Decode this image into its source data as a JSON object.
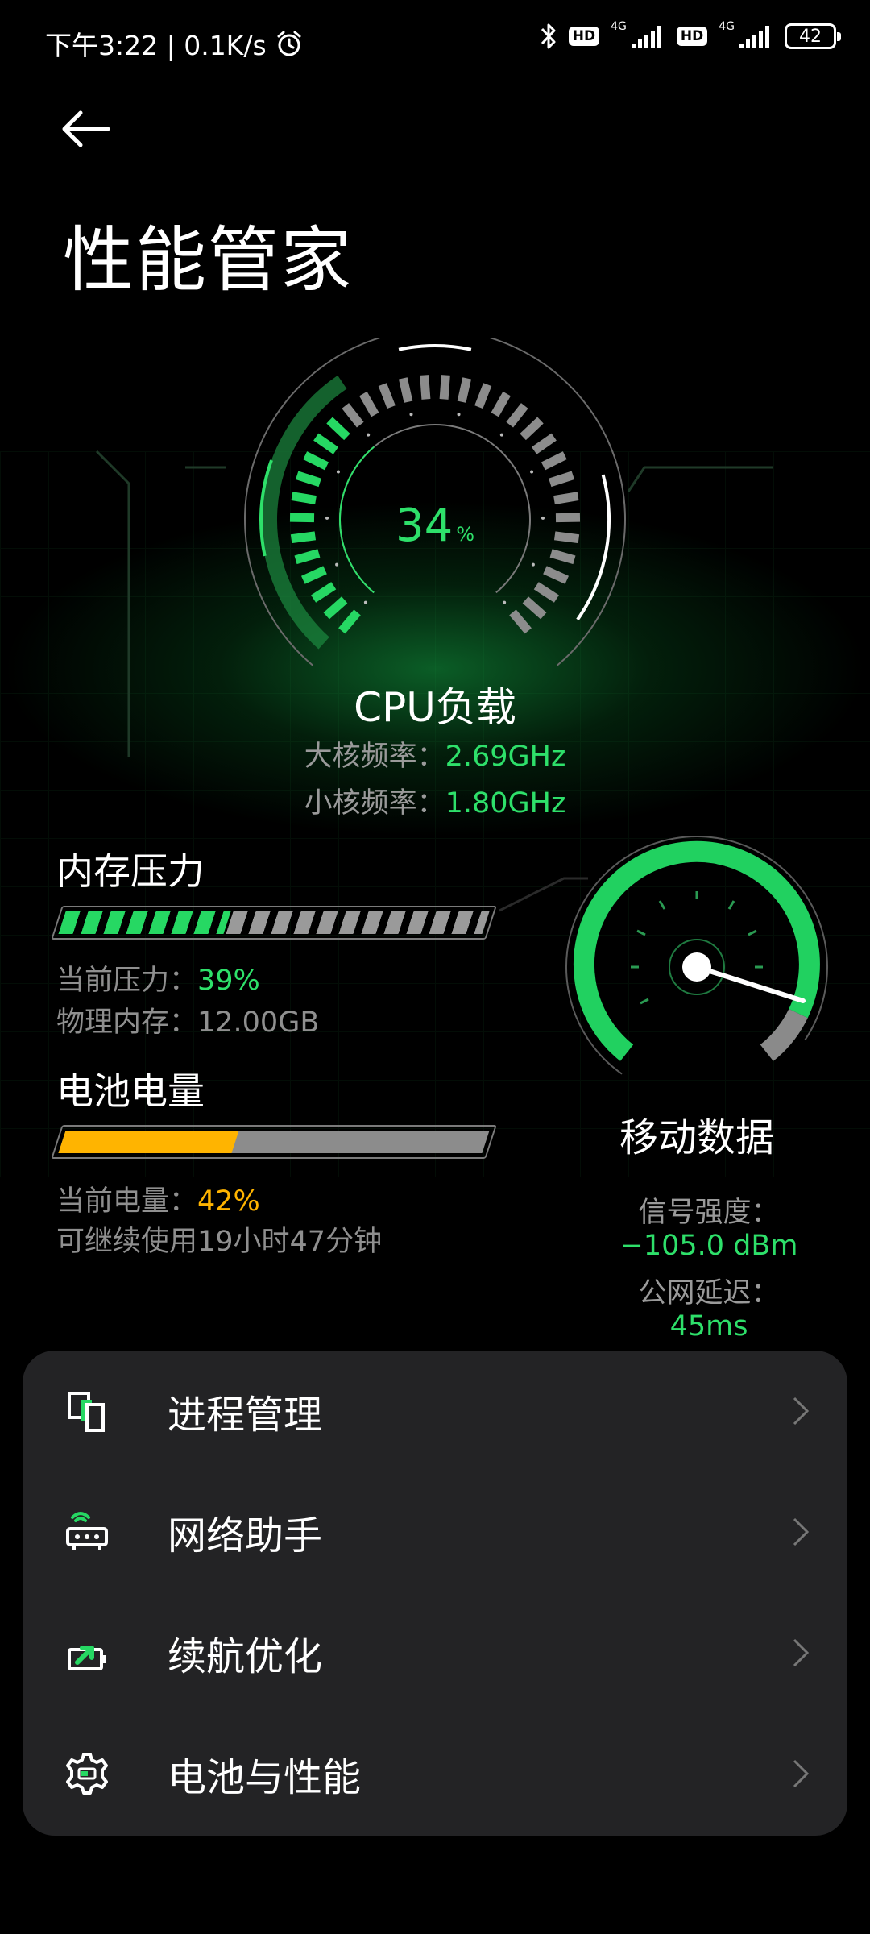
{
  "status_bar": {
    "time_speed": "下午3:22 | 0.1K/s",
    "hd1": "HD",
    "net1": "4G",
    "hd2": "HD",
    "net2": "4G",
    "battery": "42"
  },
  "header": {
    "title": "性能管家"
  },
  "cpu": {
    "load_value": "34",
    "load_unit": "%",
    "load_fraction": 0.34,
    "label": "CPU负载",
    "big_core_label": "大核频率：",
    "big_core_value": "2.69GHz",
    "little_core_label": "小核频率：",
    "little_core_value": "1.80GHz"
  },
  "memory": {
    "title": "内存压力",
    "pressure_fraction": 0.39,
    "pressure_label": "当前压力：",
    "pressure_value": "39%",
    "physical_label": "物理内存：12.00GB"
  },
  "battery": {
    "title": "电池电量",
    "level_fraction": 0.42,
    "level_label": "当前电量：",
    "level_value": "42%",
    "remaining": "可继续使用19小时47分钟"
  },
  "mobile_data": {
    "title": "移动数据",
    "signal_label": "信号强度：",
    "signal_value": "−105.0 dBm",
    "latency_label": "公网延迟：",
    "latency_value": "45ms"
  },
  "menu": {
    "items": [
      {
        "label": "进程管理",
        "icon": "process-icon"
      },
      {
        "label": "网络助手",
        "icon": "router-icon"
      },
      {
        "label": "续航优化",
        "icon": "battery-boost-icon"
      },
      {
        "label": "电池与性能",
        "icon": "gear-icon"
      }
    ]
  },
  "colors": {
    "accent_green": "#2ee06a",
    "battery_yellow": "#ffb400",
    "card_bg": "#232325"
  }
}
